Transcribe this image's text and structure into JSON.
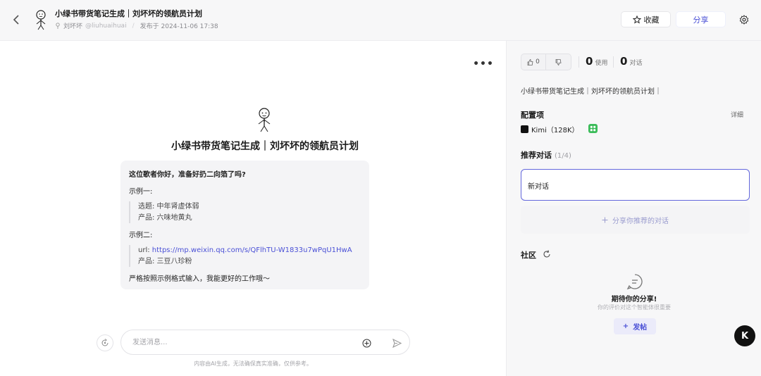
{
  "header": {
    "title": "小绿书带货笔记生成｜刘坏坏的领航员计划",
    "author": "刘坏坏",
    "handle": "@liuhuaihuai",
    "published": "发布于 2024-11-06 17:38",
    "favorite_label": "收藏",
    "share_label": "分享"
  },
  "main": {
    "bot_title": "小绿书带货笔记生成｜刘坏坏的领航员计划",
    "message": {
      "greeting": "这位歌者你好，准备好扔二向箔了吗?",
      "example1_label": "示例一:",
      "example1_line1": "选题: 中年肾虚体弱",
      "example1_line2": "产品: 六味地黄丸",
      "example2_label": "示例二:",
      "example2_url_prefix": "url: ",
      "example2_url": "https://mp.weixin.qq.com/s/QFlhTU-W1833u7wPqU1HwA",
      "example2_line2": "产品: 三豆八珍粉",
      "closing": "严格按照示例格式输入，我能更好的工作哦～"
    },
    "input_placeholder": "发送消息...",
    "disclaimer": "内容由AI生成，无法确保真实准确，仅供参考。"
  },
  "side": {
    "likes": "0",
    "uses_count": "0",
    "uses_label": "使用",
    "chats_count": "0",
    "chats_label": "对话",
    "description": "小绿书带货笔记生成｜刘坏坏的领航员计划｜",
    "config_title": "配置项",
    "detail_label": "详细",
    "model": "Kimi（128K）",
    "recommended_title": "推荐对话",
    "recommended_count": "(1/4)",
    "new_chat": "新对话",
    "share_rec_label": "分享你推荐的对话",
    "community_title": "社区",
    "empty_title": "期待你的分享!",
    "empty_sub": "你的评价对这个智能体很重要",
    "post_label": "发帖"
  },
  "fab_label": "K",
  "colors": {
    "accent": "#4a50d6",
    "plugin": "#3cbc5a"
  }
}
